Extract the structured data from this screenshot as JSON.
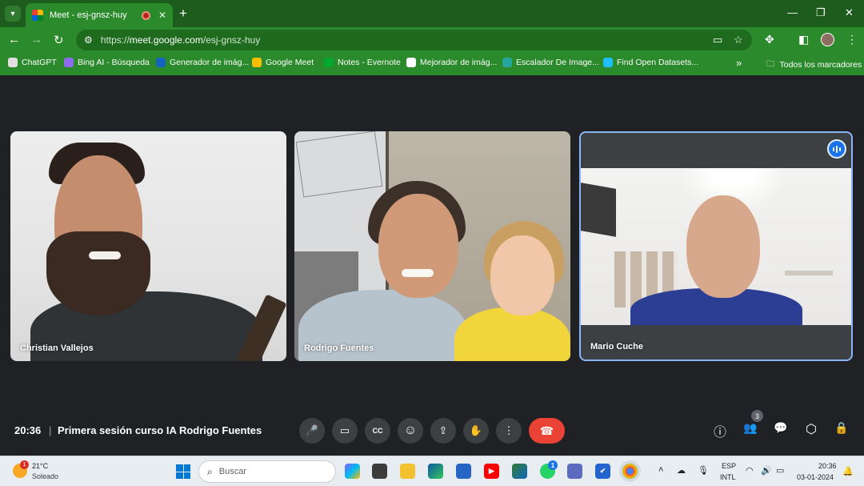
{
  "browser": {
    "tab_title": "Meet - esj-gnsz-huy",
    "tab_close": "✕",
    "new_tab": "+",
    "url_scheme": "https://",
    "url_host": "meet.google.com",
    "url_path": "/esj-gnsz-huy",
    "window_controls": {
      "minimize": "—",
      "maximize": "❐",
      "close": "✕"
    },
    "bookmarks": [
      {
        "label": "ChatGPT",
        "color": "#e0e0e0"
      },
      {
        "label": "Bing AI - Búsqueda",
        "color": "#8e6cf0"
      },
      {
        "label": "Generador de imág...",
        "color": "#1565c0"
      },
      {
        "label": "Google Meet",
        "color": "#fbbc04"
      },
      {
        "label": "Notes - Evernote",
        "color": "#00a82d"
      },
      {
        "label": "Mejorador de imág...",
        "color": "#ffffff"
      },
      {
        "label": "Escalador De Image...",
        "color": "#26a69a"
      },
      {
        "label": "Find Open Datasets...",
        "color": "#20beff"
      }
    ],
    "bookmarks_more": "»",
    "all_bookmarks": "Todos los marcadores",
    "theme_color": "#2b8a2b"
  },
  "meet": {
    "participants": [
      {
        "name": "Christian Vallejos"
      },
      {
        "name": "Rodrigo Fuentes"
      },
      {
        "name": "Mario Cuche",
        "speaking": true
      }
    ],
    "clock": "20:36",
    "separator": "|",
    "meeting_title": "Primera sesión curso IA Rodrigo Fuentes",
    "controls": {
      "mic": "🎤",
      "camera": "▭",
      "captions": "CC",
      "reactions": "☺",
      "present": "⇪",
      "raise_hand": "✋",
      "more": "⋮",
      "hangup": "☎"
    },
    "right_controls": {
      "info": "ⓘ",
      "people": "👥",
      "chat": "💬",
      "activities": "⬡",
      "host": "🔒"
    },
    "participant_count": "3",
    "hangup_color": "#ea4335",
    "speaking_color": "#1a73e8"
  },
  "taskbar": {
    "weather_temp": "21°C",
    "weather_condition": "Soleado",
    "weather_badge": "1",
    "search_placeholder": "Buscar",
    "whatsapp_badge": "1",
    "lang_top": "ESP",
    "lang_bottom": "INTL",
    "time": "20:36",
    "date": "03-01-2024"
  }
}
